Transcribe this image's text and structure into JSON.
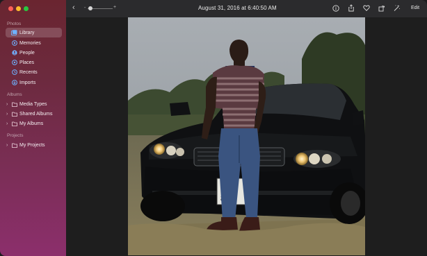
{
  "window": {
    "controls": [
      "close",
      "minimize",
      "zoom"
    ]
  },
  "sidebar": {
    "sections": {
      "photos_title": "Photos",
      "albums_title": "Albums",
      "projects_title": "Projects"
    },
    "photos_items": [
      {
        "label": "Library",
        "icon": "library-icon",
        "selected": true
      },
      {
        "label": "Memories",
        "icon": "memories-icon"
      },
      {
        "label": "People",
        "icon": "people-icon"
      },
      {
        "label": "Places",
        "icon": "places-icon"
      },
      {
        "label": "Recents",
        "icon": "clock-icon"
      },
      {
        "label": "Imports",
        "icon": "import-icon"
      }
    ],
    "album_items": [
      {
        "label": "Media Types",
        "icon": "folder-icon"
      },
      {
        "label": "Shared Albums",
        "icon": "folder-icon"
      },
      {
        "label": "My Albums",
        "icon": "folder-icon"
      }
    ],
    "project_items": [
      {
        "label": "My Projects",
        "icon": "folder-icon"
      }
    ]
  },
  "toolbar": {
    "title": "August 31, 2016 at 6:40:50 AM",
    "zoom_minus": "-",
    "zoom_plus": "+",
    "edit_label": "Edit",
    "icons": [
      "back-icon",
      "info-icon",
      "share-icon",
      "favorite-icon",
      "rotate-icon",
      "enhance-icon"
    ]
  },
  "colors": {
    "sidebar_top": "#6a2530",
    "sidebar_bottom": "#8c2f6c",
    "toolbar_bg": "#2b2b2d",
    "content_bg": "#1e1e1e"
  }
}
